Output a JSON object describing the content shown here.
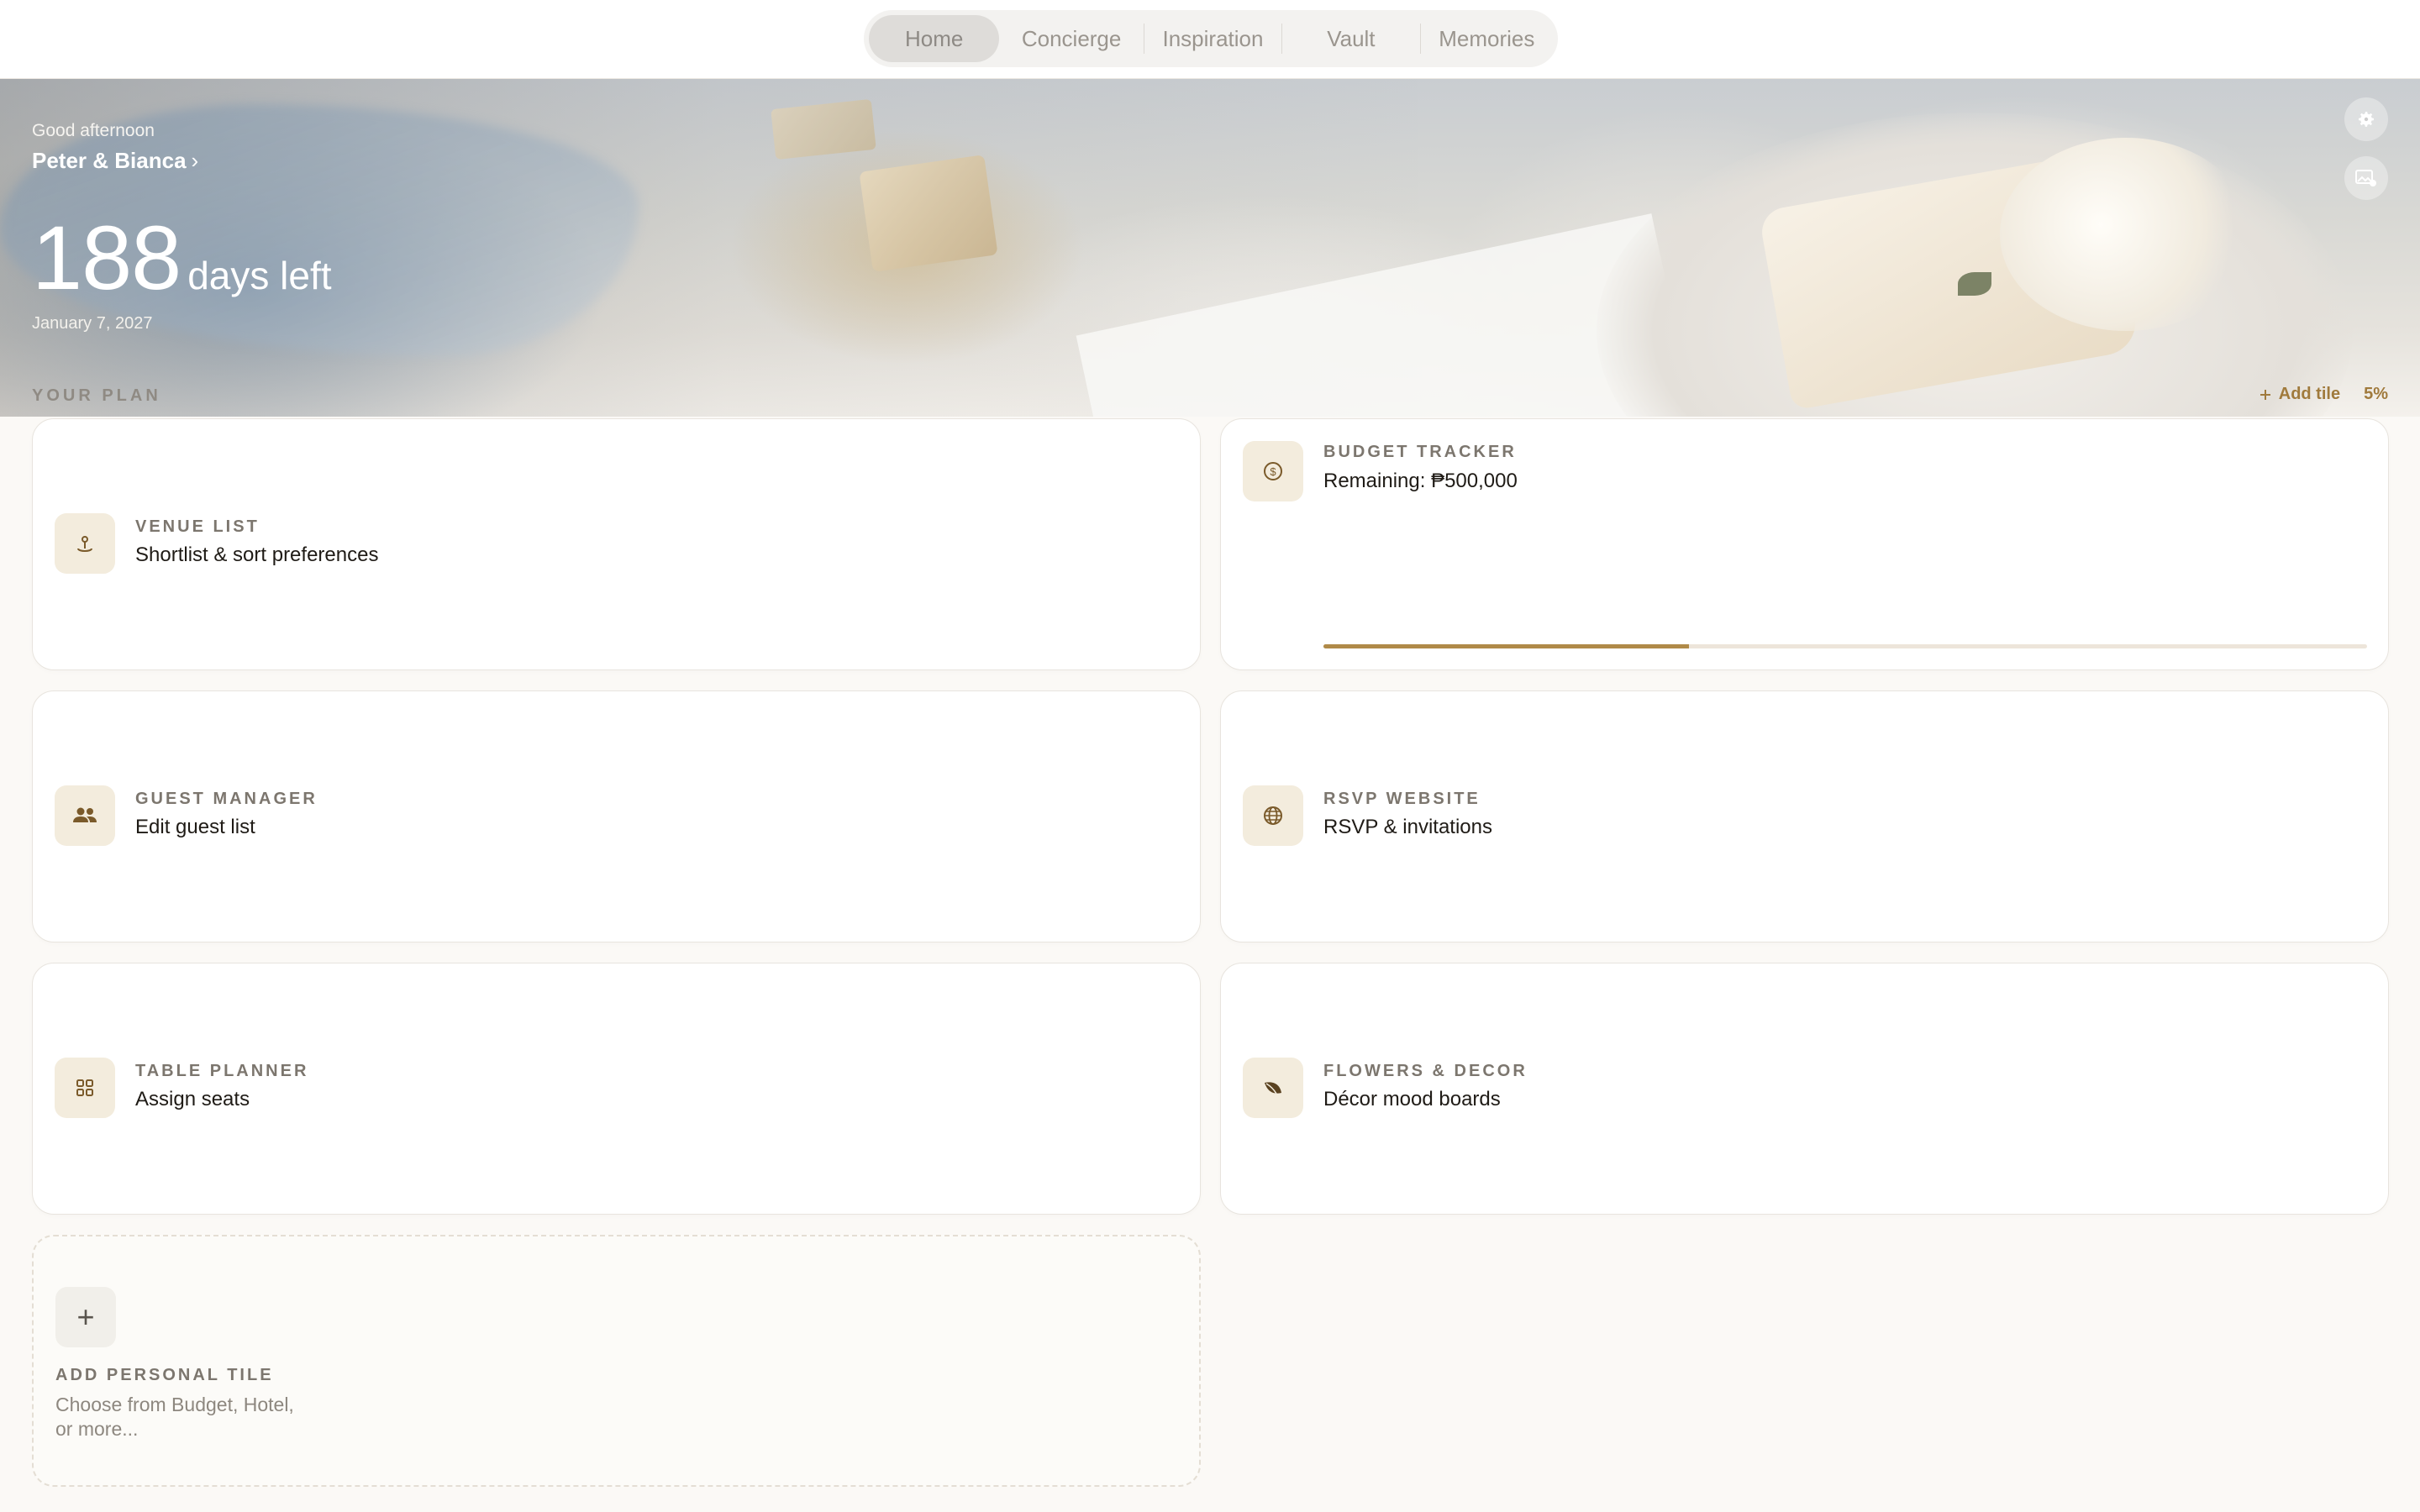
{
  "nav": {
    "tabs": [
      {
        "label": "Home",
        "active": true
      },
      {
        "label": "Concierge",
        "active": false
      },
      {
        "label": "Inspiration",
        "active": false
      },
      {
        "label": "Vault",
        "active": false
      },
      {
        "label": "Memories",
        "active": false
      }
    ]
  },
  "hero": {
    "greeting": "Good afternoon",
    "couple_name": "Peter & Bianca",
    "couple_chevron": "›",
    "days_count": "188",
    "days_unit": "days left",
    "wedding_date": "January 7, 2027",
    "icons": {
      "settings": "gear-icon",
      "change_photo": "image-edit-icon"
    }
  },
  "plan": {
    "section_label": "YOUR PLAN",
    "add_tile_label": "Add tile",
    "progress_label": "5%",
    "tiles": [
      {
        "key": "venue",
        "title": "VENUE LIST",
        "subtitle": "Shortlist & sort preferences",
        "icon": "location-pin-icon"
      },
      {
        "key": "budget",
        "title": "BUDGET TRACKER",
        "subtitle": "Remaining: ₱500,000",
        "icon": "dollar-coin-icon",
        "progress_fraction": 0.35
      },
      {
        "key": "guests",
        "title": "GUEST MANAGER",
        "subtitle": "Edit guest list",
        "icon": "people-icon"
      },
      {
        "key": "rsvp",
        "title": "RSVP WEBSITE",
        "subtitle": "RSVP & invitations",
        "icon": "globe-icon"
      },
      {
        "key": "tables",
        "title": "TABLE PLANNER",
        "subtitle": "Assign seats",
        "icon": "grid-icon"
      },
      {
        "key": "flowers",
        "title": "FLOWERS & DECOR",
        "subtitle": "Décor mood boards",
        "icon": "leaf-icon"
      }
    ],
    "add_personal": {
      "symbol": "+",
      "title": "ADD PERSONAL TILE",
      "subtitle": "Choose from Budget, Hotel, or more..."
    }
  },
  "colors": {
    "accent": "#b08a48",
    "accent_text": "#a07a3c",
    "icon_bg": "#f3ecdd",
    "icon_fg": "#7a5a2a"
  }
}
